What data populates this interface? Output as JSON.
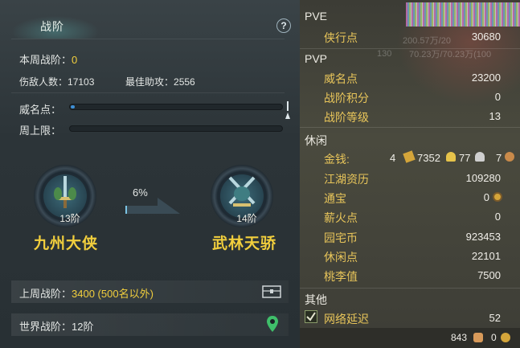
{
  "left": {
    "tab_title": "战阶",
    "help": "?",
    "this_week_label": "本周战阶：",
    "this_week_value": "0",
    "kills_label": "伤敌人数：",
    "kills_value": "17103",
    "best_assist_label": "最佳助攻：",
    "best_assist_value": "2556",
    "prestige_label": "威名点：",
    "prestige_progress": 0.02,
    "weekly_cap_label": "周上限：",
    "weekly_cap_progress": 0,
    "current_rank": {
      "level": "13阶",
      "name": "九州大侠"
    },
    "next_rank": {
      "level": "14阶",
      "name": "武林天骄"
    },
    "progress_pct": "6%",
    "last_week_label": "上周战阶：",
    "last_week_value": "3400 (500名以外)",
    "world_label": "世界战阶：",
    "world_value": "12阶"
  },
  "right": {
    "pve": {
      "title": "PVE",
      "items": [
        {
          "label": "侠行点",
          "value": "30680"
        }
      ]
    },
    "pvp": {
      "title": "PVP",
      "items": [
        {
          "label": "威名点",
          "value": "23200"
        },
        {
          "label": "战阶积分",
          "value": "0"
        },
        {
          "label": "战阶等级",
          "value": "13"
        }
      ]
    },
    "leisure": {
      "title": "休闲",
      "money_label": "金钱:",
      "money_gold": "4",
      "money_silver": "7352",
      "money_copper1": "77",
      "money_copper2": "7",
      "items": [
        {
          "label": "江湖资历",
          "value": "109280"
        },
        {
          "label": "通宝",
          "value": "0"
        },
        {
          "label": "薪火点",
          "value": "0"
        },
        {
          "label": "园宅币",
          "value": "923453"
        },
        {
          "label": "休闲点",
          "value": "22101"
        },
        {
          "label": "桃李值",
          "value": "7500"
        }
      ]
    },
    "other": {
      "title": "其他",
      "latency_label": "网络延迟",
      "latency_value": "52"
    },
    "bottom": {
      "count1": "843",
      "count2": "0"
    },
    "ghost": {
      "a": "200.57万/20",
      "b": "130",
      "c": "70.23万/70.23万(100"
    }
  }
}
